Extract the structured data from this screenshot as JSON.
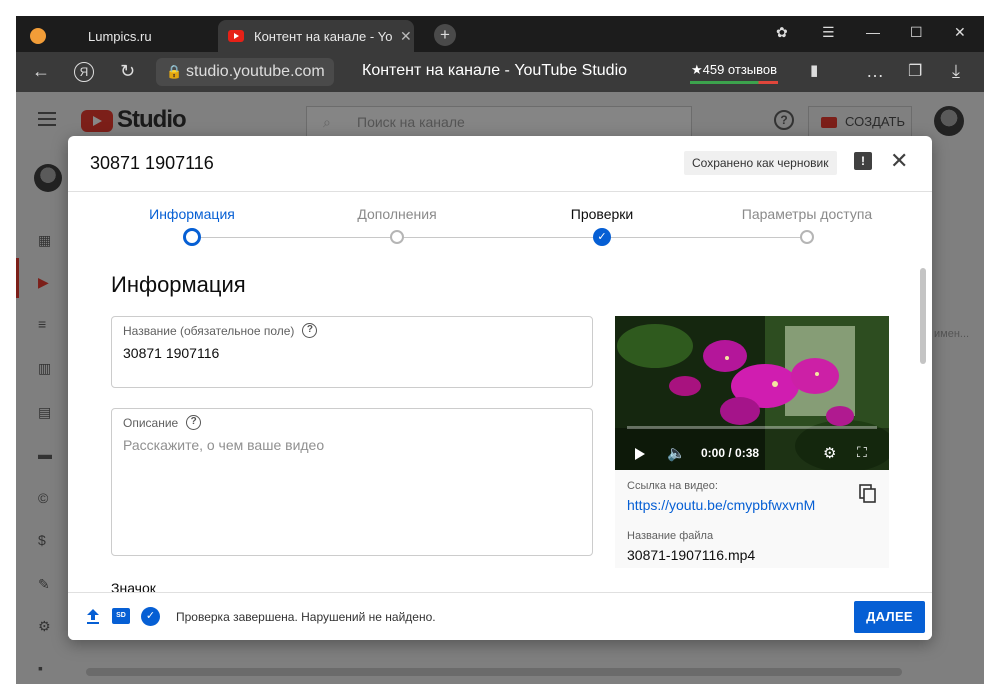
{
  "browser": {
    "tabs": [
      {
        "label": "Lumpics.ru"
      },
      {
        "label": "Контент на канале - Yo"
      }
    ],
    "url": "studio.youtube.com",
    "page_title": "Контент на канале - YouTube Studio",
    "reviews": "★459 отзывов"
  },
  "studio": {
    "logo_text": "Studio",
    "search_placeholder": "Поиск на канале",
    "create_label": "СОЗДАТЬ",
    "help_glyph": "?",
    "bg_snippet": "имен..."
  },
  "modal": {
    "title": "30871 1907116",
    "draft_badge": "Сохранено как черновик",
    "steps": [
      {
        "label": "Информация",
        "state": "active"
      },
      {
        "label": "Дополнения",
        "state": "pending"
      },
      {
        "label": "Проверки",
        "state": "done"
      },
      {
        "label": "Параметры доступа",
        "state": "pending"
      }
    ],
    "section_title": "Информация",
    "title_field": {
      "label": "Название (обязательное поле)",
      "value": "30871 1907116"
    },
    "description_field": {
      "label": "Описание",
      "placeholder": "Расскажите, о чем ваше видео"
    },
    "thumbnail_label": "Значок",
    "video": {
      "time": "0:00 / 0:38",
      "progress": 0,
      "link_label": "Ссылка на видео:",
      "link_url": "https://youtu.be/cmypbfwxvnM",
      "filename_label": "Название файла",
      "filename": "30871-1907116.mp4"
    },
    "footer": {
      "sd_badge": "SD",
      "status": "Проверка завершена. Нарушений не найдено.",
      "next_label": "ДАЛЕЕ"
    }
  },
  "colors": {
    "accent": "#065fd4",
    "overlay": "#7f7f7f",
    "youtube_red": "#e62117"
  }
}
